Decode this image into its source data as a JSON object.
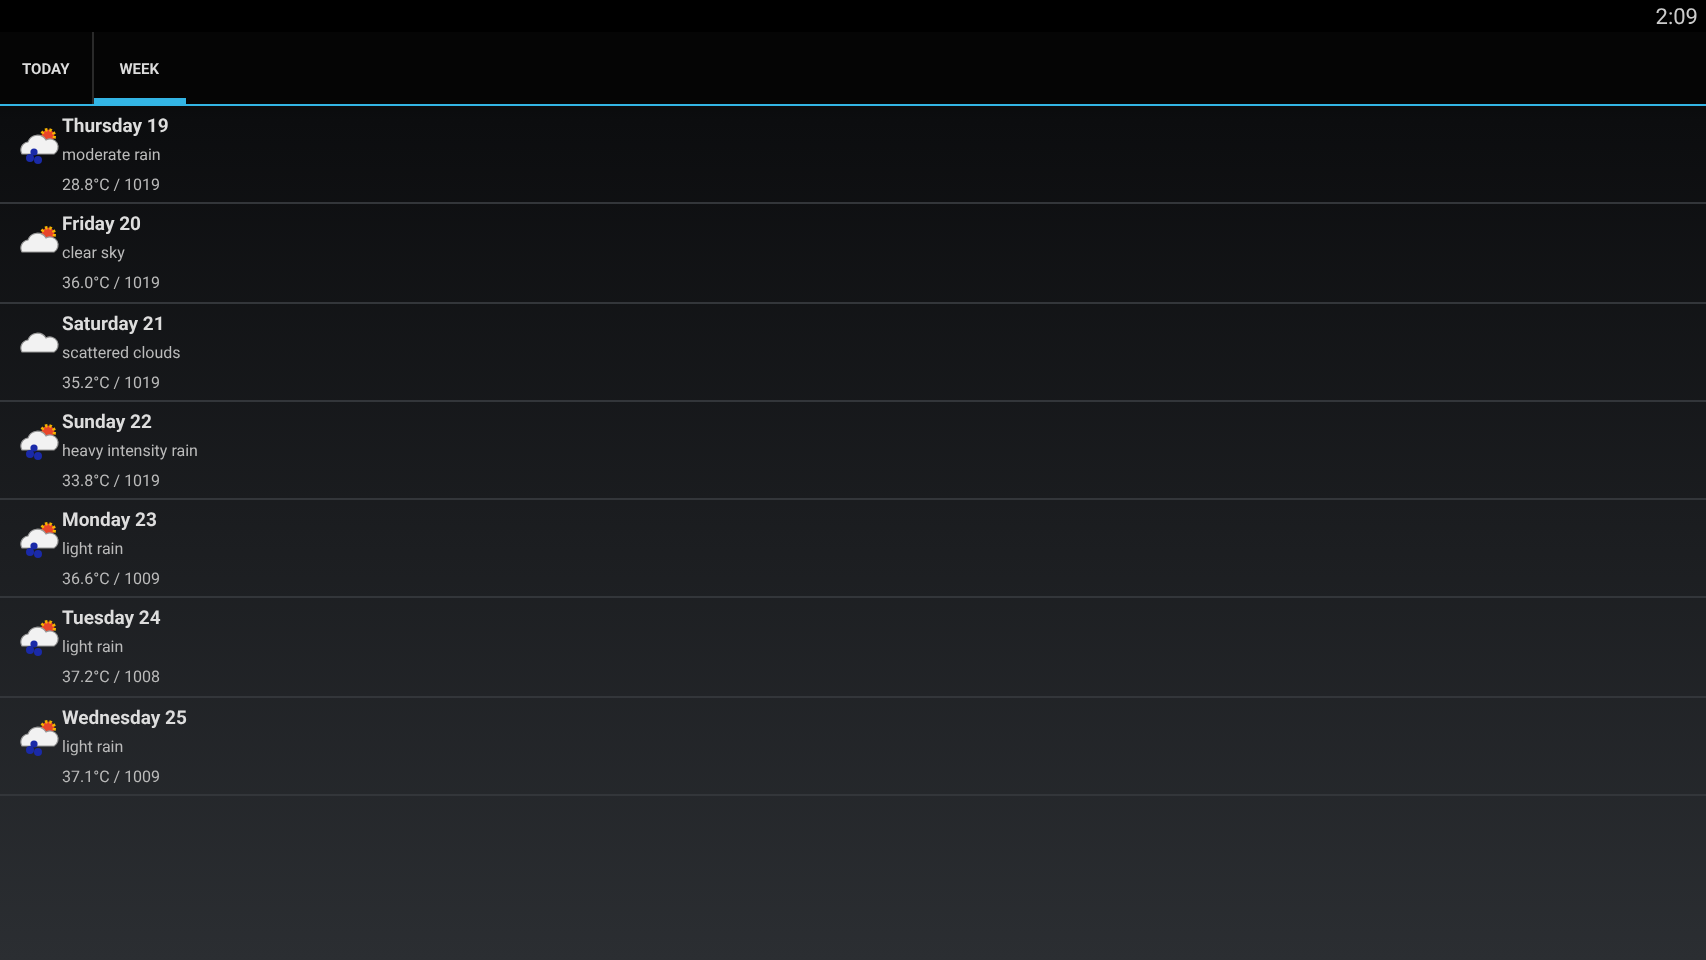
{
  "status_bar": {
    "time": "2:09"
  },
  "tabs": [
    {
      "label": "TODAY",
      "selected": false
    },
    {
      "label": "WEEK",
      "selected": true
    }
  ],
  "days": [
    {
      "day": "Thursday 19",
      "description": "moderate rain",
      "reading": "28.8°C / 1019",
      "kind": "rain"
    },
    {
      "day": "Friday 20",
      "description": "clear sky",
      "reading": "36.0°C / 1019",
      "kind": "sun-cloud"
    },
    {
      "day": "Saturday 21",
      "description": "scattered clouds",
      "reading": "35.2°C / 1019",
      "kind": "cloud"
    },
    {
      "day": "Sunday 22",
      "description": "heavy intensity rain",
      "reading": "33.8°C / 1019",
      "kind": "rain"
    },
    {
      "day": "Monday 23",
      "description": "light rain",
      "reading": "36.6°C / 1009",
      "kind": "rain"
    },
    {
      "day": "Tuesday 24",
      "description": "light rain",
      "reading": "37.2°C / 1008",
      "kind": "rain"
    },
    {
      "day": "Wednesday 25",
      "description": "light rain",
      "reading": "37.1°C / 1009",
      "kind": "rain"
    }
  ]
}
